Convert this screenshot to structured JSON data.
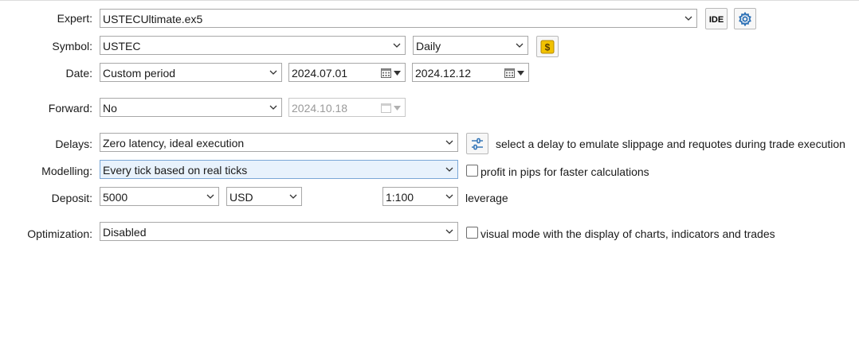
{
  "expert": {
    "label": "Expert:",
    "value": "USTECUltimate.ex5",
    "ide_button": "IDE",
    "settings_icon": "gear-icon"
  },
  "symbol": {
    "label": "Symbol:",
    "value": "USTEC",
    "timeframe": "Daily",
    "symbol_icon": "dollar-icon"
  },
  "date": {
    "label": "Date:",
    "mode": "Custom period",
    "from": "2024.07.01",
    "to": "2024.12.12"
  },
  "forward": {
    "label": "Forward:",
    "value": "No",
    "date": "2024.10.18"
  },
  "delays": {
    "label": "Delays:",
    "value": "Zero latency, ideal execution",
    "hint": "select a delay to emulate slippage and requotes during trade execution",
    "settings_icon": "sliders-icon"
  },
  "modelling": {
    "label": "Modelling:",
    "value": "Every tick based on real ticks",
    "checkbox_label": "profit in pips for faster calculations"
  },
  "deposit": {
    "label": "Deposit:",
    "amount": "5000",
    "currency": "USD",
    "leverage": "1:100",
    "leverage_label": "leverage"
  },
  "optimization": {
    "label": "Optimization:",
    "value": "Disabled",
    "checkbox_label": "visual mode with the display of charts, indicators and trades"
  },
  "colors": {
    "accent": "#2a6fb5",
    "highlight": "#e8f2fc",
    "dollar": "#f2c200"
  }
}
